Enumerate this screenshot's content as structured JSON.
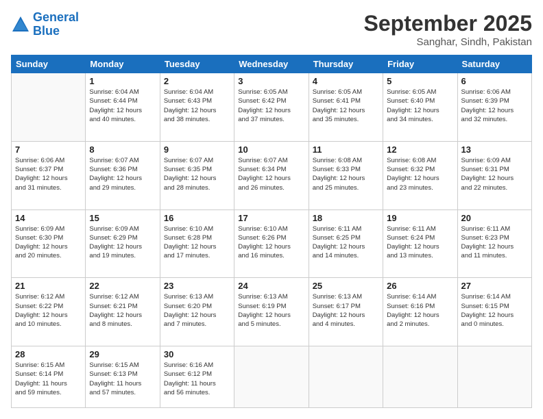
{
  "header": {
    "logo_line1": "General",
    "logo_line2": "Blue",
    "month": "September 2025",
    "location": "Sanghar, Sindh, Pakistan"
  },
  "weekdays": [
    "Sunday",
    "Monday",
    "Tuesday",
    "Wednesday",
    "Thursday",
    "Friday",
    "Saturday"
  ],
  "weeks": [
    [
      {
        "day": "",
        "info": ""
      },
      {
        "day": "1",
        "info": "Sunrise: 6:04 AM\nSunset: 6:44 PM\nDaylight: 12 hours\nand 40 minutes."
      },
      {
        "day": "2",
        "info": "Sunrise: 6:04 AM\nSunset: 6:43 PM\nDaylight: 12 hours\nand 38 minutes."
      },
      {
        "day": "3",
        "info": "Sunrise: 6:05 AM\nSunset: 6:42 PM\nDaylight: 12 hours\nand 37 minutes."
      },
      {
        "day": "4",
        "info": "Sunrise: 6:05 AM\nSunset: 6:41 PM\nDaylight: 12 hours\nand 35 minutes."
      },
      {
        "day": "5",
        "info": "Sunrise: 6:05 AM\nSunset: 6:40 PM\nDaylight: 12 hours\nand 34 minutes."
      },
      {
        "day": "6",
        "info": "Sunrise: 6:06 AM\nSunset: 6:39 PM\nDaylight: 12 hours\nand 32 minutes."
      }
    ],
    [
      {
        "day": "7",
        "info": "Sunrise: 6:06 AM\nSunset: 6:37 PM\nDaylight: 12 hours\nand 31 minutes."
      },
      {
        "day": "8",
        "info": "Sunrise: 6:07 AM\nSunset: 6:36 PM\nDaylight: 12 hours\nand 29 minutes."
      },
      {
        "day": "9",
        "info": "Sunrise: 6:07 AM\nSunset: 6:35 PM\nDaylight: 12 hours\nand 28 minutes."
      },
      {
        "day": "10",
        "info": "Sunrise: 6:07 AM\nSunset: 6:34 PM\nDaylight: 12 hours\nand 26 minutes."
      },
      {
        "day": "11",
        "info": "Sunrise: 6:08 AM\nSunset: 6:33 PM\nDaylight: 12 hours\nand 25 minutes."
      },
      {
        "day": "12",
        "info": "Sunrise: 6:08 AM\nSunset: 6:32 PM\nDaylight: 12 hours\nand 23 minutes."
      },
      {
        "day": "13",
        "info": "Sunrise: 6:09 AM\nSunset: 6:31 PM\nDaylight: 12 hours\nand 22 minutes."
      }
    ],
    [
      {
        "day": "14",
        "info": "Sunrise: 6:09 AM\nSunset: 6:30 PM\nDaylight: 12 hours\nand 20 minutes."
      },
      {
        "day": "15",
        "info": "Sunrise: 6:09 AM\nSunset: 6:29 PM\nDaylight: 12 hours\nand 19 minutes."
      },
      {
        "day": "16",
        "info": "Sunrise: 6:10 AM\nSunset: 6:28 PM\nDaylight: 12 hours\nand 17 minutes."
      },
      {
        "day": "17",
        "info": "Sunrise: 6:10 AM\nSunset: 6:26 PM\nDaylight: 12 hours\nand 16 minutes."
      },
      {
        "day": "18",
        "info": "Sunrise: 6:11 AM\nSunset: 6:25 PM\nDaylight: 12 hours\nand 14 minutes."
      },
      {
        "day": "19",
        "info": "Sunrise: 6:11 AM\nSunset: 6:24 PM\nDaylight: 12 hours\nand 13 minutes."
      },
      {
        "day": "20",
        "info": "Sunrise: 6:11 AM\nSunset: 6:23 PM\nDaylight: 12 hours\nand 11 minutes."
      }
    ],
    [
      {
        "day": "21",
        "info": "Sunrise: 6:12 AM\nSunset: 6:22 PM\nDaylight: 12 hours\nand 10 minutes."
      },
      {
        "day": "22",
        "info": "Sunrise: 6:12 AM\nSunset: 6:21 PM\nDaylight: 12 hours\nand 8 minutes."
      },
      {
        "day": "23",
        "info": "Sunrise: 6:13 AM\nSunset: 6:20 PM\nDaylight: 12 hours\nand 7 minutes."
      },
      {
        "day": "24",
        "info": "Sunrise: 6:13 AM\nSunset: 6:19 PM\nDaylight: 12 hours\nand 5 minutes."
      },
      {
        "day": "25",
        "info": "Sunrise: 6:13 AM\nSunset: 6:17 PM\nDaylight: 12 hours\nand 4 minutes."
      },
      {
        "day": "26",
        "info": "Sunrise: 6:14 AM\nSunset: 6:16 PM\nDaylight: 12 hours\nand 2 minutes."
      },
      {
        "day": "27",
        "info": "Sunrise: 6:14 AM\nSunset: 6:15 PM\nDaylight: 12 hours\nand 0 minutes."
      }
    ],
    [
      {
        "day": "28",
        "info": "Sunrise: 6:15 AM\nSunset: 6:14 PM\nDaylight: 11 hours\nand 59 minutes."
      },
      {
        "day": "29",
        "info": "Sunrise: 6:15 AM\nSunset: 6:13 PM\nDaylight: 11 hours\nand 57 minutes."
      },
      {
        "day": "30",
        "info": "Sunrise: 6:16 AM\nSunset: 6:12 PM\nDaylight: 11 hours\nand 56 minutes."
      },
      {
        "day": "",
        "info": ""
      },
      {
        "day": "",
        "info": ""
      },
      {
        "day": "",
        "info": ""
      },
      {
        "day": "",
        "info": ""
      }
    ]
  ]
}
